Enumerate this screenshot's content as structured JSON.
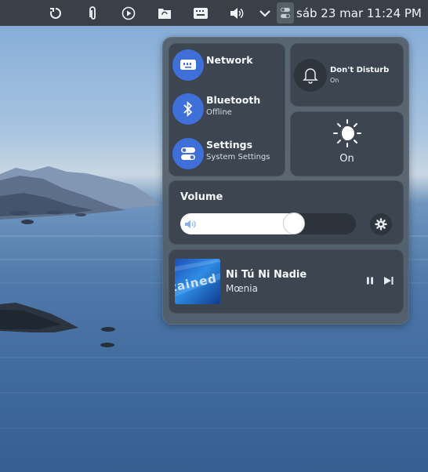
{
  "topbar": {
    "icons": [
      "refresh-icon",
      "paperclip-icon",
      "play-circle-icon",
      "folder-sync-icon",
      "keyboard-icon",
      "volume-icon",
      "chevron-down-icon",
      "control-center-icon"
    ],
    "clock": "sáb 23 mar 11:24 PM"
  },
  "control_center": {
    "network": {
      "title": "Network",
      "icon": "network-icon"
    },
    "bluetooth": {
      "title": "Bluetooth",
      "status": "Offline",
      "icon": "bluetooth-icon"
    },
    "settings": {
      "title": "Settings",
      "subtitle": "System Settings",
      "icon": "settings-toggle-icon"
    },
    "dnd": {
      "title": "Don't Disturb",
      "status": "On",
      "icon": "bell-icon"
    },
    "night_light": {
      "label": "On",
      "icon": "day-night-icon"
    },
    "volume": {
      "title": "Volume",
      "level": 0.67,
      "icon": "speaker-icon",
      "settings_icon": "gear-icon"
    },
    "media": {
      "title": "Ni Tú Ni Nadie",
      "artist": "Mœnia",
      "cover_text": "tained n",
      "pause_icon": "pause-icon",
      "next_icon": "next-icon"
    }
  },
  "colors": {
    "accent": "#3f6fd9",
    "panel": "#535e68",
    "card": "#3c4550",
    "topbar": "#3a4048"
  }
}
